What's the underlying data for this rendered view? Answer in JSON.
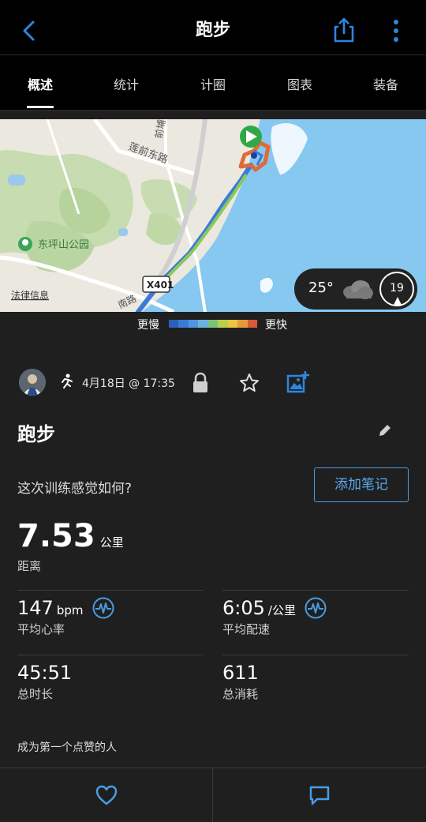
{
  "header": {
    "title": "跑步",
    "back_icon": "chevron-left-icon",
    "share_icon": "share-icon",
    "more_icon": "more-vertical-icon",
    "accent": "#2d86e0"
  },
  "tabs": [
    {
      "label": "概述",
      "active": true
    },
    {
      "label": "统计",
      "active": false
    },
    {
      "label": "计圈",
      "active": false
    },
    {
      "label": "图表",
      "active": false
    },
    {
      "label": "装备",
      "active": false
    }
  ],
  "map": {
    "labels": {
      "road1": "莲前东路",
      "road2": "前埔",
      "park": "东坪山公园",
      "legal": "法律信息",
      "highway": "X401",
      "road3": "南路"
    },
    "weather": {
      "temperature": "25°",
      "wind": "19",
      "icon": "cloud-icon"
    }
  },
  "legend": {
    "slow": "更慢",
    "fast": "更快",
    "colors": [
      "#2b5fb8",
      "#3a7ad6",
      "#4f96e0",
      "#6cb2df",
      "#7cc37a",
      "#b9cf4c",
      "#e9c542",
      "#e59a36",
      "#d9593a"
    ]
  },
  "activity": {
    "date": "4月18日 @ 17:35",
    "title": "跑步",
    "question": "这次训练感觉如何?",
    "add_note": "添加笔记",
    "distance": {
      "value": "7.53",
      "unit": "公里",
      "label": "距离"
    },
    "stats": [
      {
        "value": "147",
        "unit": "bpm",
        "label": "平均心率"
      },
      {
        "value": "6:05",
        "unit": "/公里",
        "label": "平均配速"
      },
      {
        "value": "45:51",
        "unit": "",
        "label": "总时长"
      },
      {
        "value": "611",
        "unit": "",
        "label": "总消耗"
      }
    ],
    "likes_text": "成为第一个点赞的人"
  }
}
